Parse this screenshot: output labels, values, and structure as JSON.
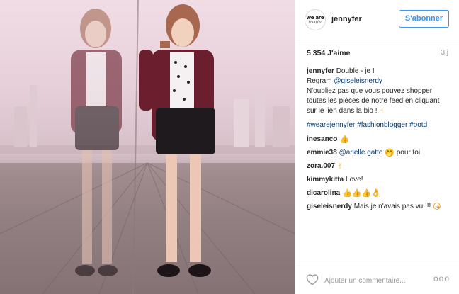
{
  "photo": {
    "alt": "Deux reflets d'une femme en gilet bordeaux et jupe noire sur une jetée"
  },
  "header": {
    "avatar_line1": "we are",
    "avatar_line2": "jennyfer",
    "username": "jennyfer",
    "follow_label": "S'abonner"
  },
  "meta": {
    "likes": "5 354 J'aime",
    "time": "3 j"
  },
  "caption": {
    "user": "jennyfer",
    "text_line1": "Double - je !",
    "regram_label": "Regram",
    "regram_mention": "@giseleisnerdy",
    "text_line3": "N'oubliez pas que vous pouvez shopper",
    "text_line4": "toutes les pièces de notre feed en cliquant",
    "text_line5": "sur le lien dans la bio !",
    "emoji_hand": "☝"
  },
  "hashtags": [
    "#wearejennyfer",
    "#fashionblogger",
    "#ootd"
  ],
  "comments": [
    {
      "user": "inesanco",
      "text": "",
      "emoji": "👍"
    },
    {
      "user": "emmie38",
      "mention": "@arielle.gatto",
      "emoji": "🤭",
      "text": "pour toi"
    },
    {
      "user": "zora.007",
      "text": "",
      "emoji": "✌"
    },
    {
      "user": "kimmykitta",
      "text": "Love!"
    },
    {
      "user": "dicarolina",
      "text": "",
      "emoji": "👍👍👍👌"
    },
    {
      "user": "giseleisnerdy",
      "text": "Mais je n'avais pas vu !!!",
      "emoji": "😘"
    }
  ],
  "footer": {
    "placeholder": "Ajouter un commentaire...",
    "more_label": "ooo"
  },
  "colors": {
    "accent": "#3897f0",
    "link": "#003569",
    "text": "#262626",
    "muted": "#999999"
  }
}
